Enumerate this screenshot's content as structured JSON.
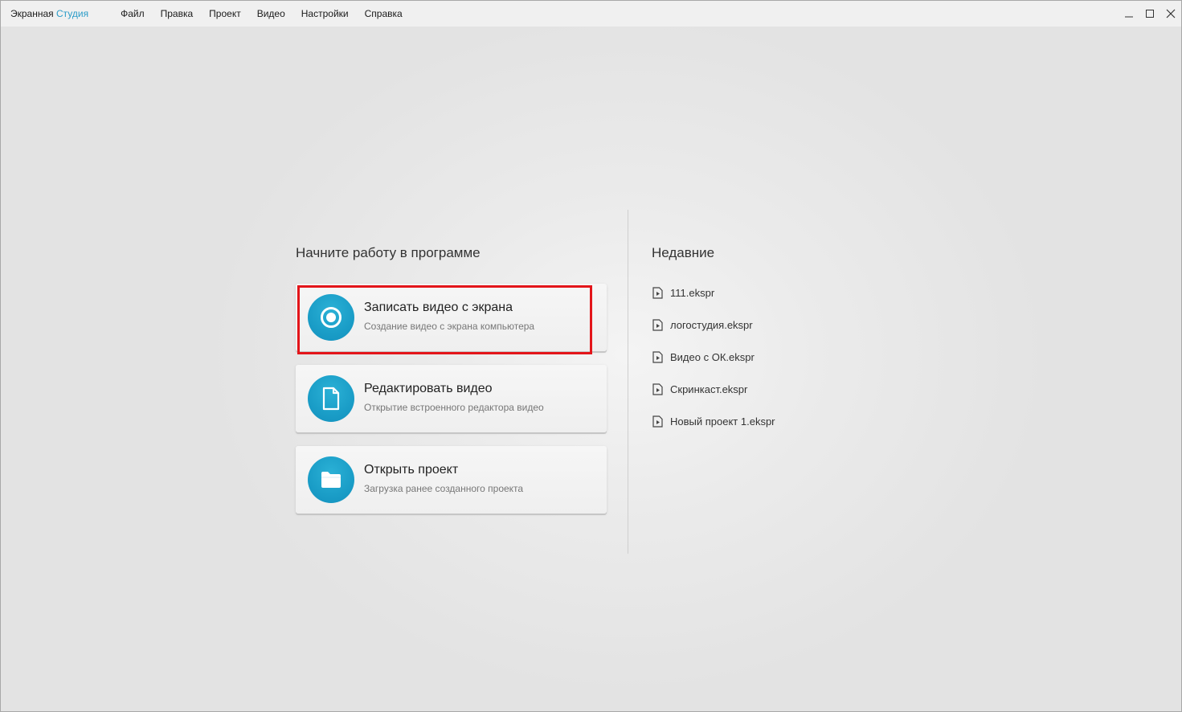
{
  "app": {
    "title_part1": "Экранная",
    "title_part2": "Студия",
    "accent_color": "#2b9cc8"
  },
  "menu": [
    "Файл",
    "Правка",
    "Проект",
    "Видео",
    "Настройки",
    "Справка"
  ],
  "window_controls": [
    "minimize-icon",
    "maximize-icon",
    "close-icon"
  ],
  "start": {
    "title": "Начните работу в программе",
    "cards": [
      {
        "icon": "record-icon",
        "title": "Записать видео с экрана",
        "subtitle": "Создание видео с экрана компьютера",
        "highlighted": true
      },
      {
        "icon": "document-icon",
        "title": "Редактировать видео",
        "subtitle": "Открытие встроенного редактора видео",
        "highlighted": false
      },
      {
        "icon": "folder-icon",
        "title": "Открыть проект",
        "subtitle": "Загрузка ранее созданного проекта",
        "highlighted": false
      }
    ]
  },
  "recent": {
    "title": "Недавние",
    "items": [
      "111.ekspr",
      "логостудия.ekspr",
      "Видео с ОК.ekspr",
      "Скринкаст.ekspr",
      "Новый проект 1.ekspr"
    ]
  },
  "colors": {
    "icon_circle": "#1a9dc7",
    "highlight_border": "#e3151a"
  }
}
